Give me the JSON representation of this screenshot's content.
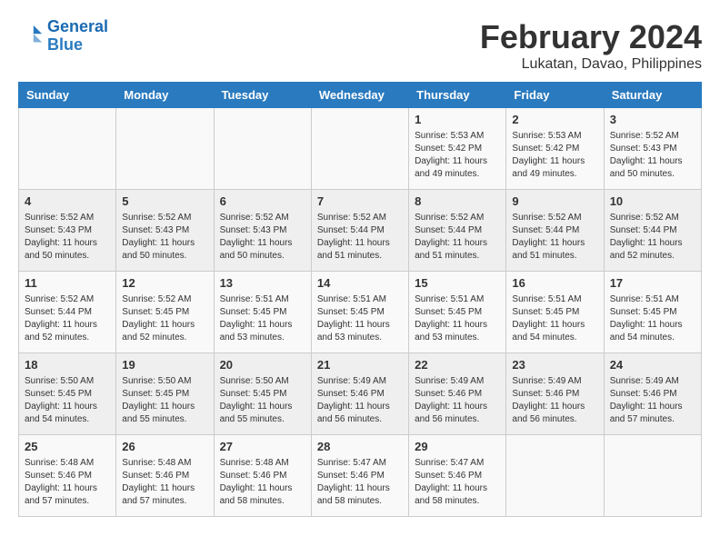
{
  "header": {
    "logo_line1": "General",
    "logo_line2": "Blue",
    "main_title": "February 2024",
    "sub_title": "Lukatan, Davao, Philippines"
  },
  "days_of_week": [
    "Sunday",
    "Monday",
    "Tuesday",
    "Wednesday",
    "Thursday",
    "Friday",
    "Saturday"
  ],
  "weeks": [
    [
      {
        "day": "",
        "info": ""
      },
      {
        "day": "",
        "info": ""
      },
      {
        "day": "",
        "info": ""
      },
      {
        "day": "",
        "info": ""
      },
      {
        "day": "1",
        "info": "Sunrise: 5:53 AM\nSunset: 5:42 PM\nDaylight: 11 hours\nand 49 minutes."
      },
      {
        "day": "2",
        "info": "Sunrise: 5:53 AM\nSunset: 5:42 PM\nDaylight: 11 hours\nand 49 minutes."
      },
      {
        "day": "3",
        "info": "Sunrise: 5:52 AM\nSunset: 5:43 PM\nDaylight: 11 hours\nand 50 minutes."
      }
    ],
    [
      {
        "day": "4",
        "info": "Sunrise: 5:52 AM\nSunset: 5:43 PM\nDaylight: 11 hours\nand 50 minutes."
      },
      {
        "day": "5",
        "info": "Sunrise: 5:52 AM\nSunset: 5:43 PM\nDaylight: 11 hours\nand 50 minutes."
      },
      {
        "day": "6",
        "info": "Sunrise: 5:52 AM\nSunset: 5:43 PM\nDaylight: 11 hours\nand 50 minutes."
      },
      {
        "day": "7",
        "info": "Sunrise: 5:52 AM\nSunset: 5:44 PM\nDaylight: 11 hours\nand 51 minutes."
      },
      {
        "day": "8",
        "info": "Sunrise: 5:52 AM\nSunset: 5:44 PM\nDaylight: 11 hours\nand 51 minutes."
      },
      {
        "day": "9",
        "info": "Sunrise: 5:52 AM\nSunset: 5:44 PM\nDaylight: 11 hours\nand 51 minutes."
      },
      {
        "day": "10",
        "info": "Sunrise: 5:52 AM\nSunset: 5:44 PM\nDaylight: 11 hours\nand 52 minutes."
      }
    ],
    [
      {
        "day": "11",
        "info": "Sunrise: 5:52 AM\nSunset: 5:44 PM\nDaylight: 11 hours\nand 52 minutes."
      },
      {
        "day": "12",
        "info": "Sunrise: 5:52 AM\nSunset: 5:45 PM\nDaylight: 11 hours\nand 52 minutes."
      },
      {
        "day": "13",
        "info": "Sunrise: 5:51 AM\nSunset: 5:45 PM\nDaylight: 11 hours\nand 53 minutes."
      },
      {
        "day": "14",
        "info": "Sunrise: 5:51 AM\nSunset: 5:45 PM\nDaylight: 11 hours\nand 53 minutes."
      },
      {
        "day": "15",
        "info": "Sunrise: 5:51 AM\nSunset: 5:45 PM\nDaylight: 11 hours\nand 53 minutes."
      },
      {
        "day": "16",
        "info": "Sunrise: 5:51 AM\nSunset: 5:45 PM\nDaylight: 11 hours\nand 54 minutes."
      },
      {
        "day": "17",
        "info": "Sunrise: 5:51 AM\nSunset: 5:45 PM\nDaylight: 11 hours\nand 54 minutes."
      }
    ],
    [
      {
        "day": "18",
        "info": "Sunrise: 5:50 AM\nSunset: 5:45 PM\nDaylight: 11 hours\nand 54 minutes."
      },
      {
        "day": "19",
        "info": "Sunrise: 5:50 AM\nSunset: 5:45 PM\nDaylight: 11 hours\nand 55 minutes."
      },
      {
        "day": "20",
        "info": "Sunrise: 5:50 AM\nSunset: 5:45 PM\nDaylight: 11 hours\nand 55 minutes."
      },
      {
        "day": "21",
        "info": "Sunrise: 5:49 AM\nSunset: 5:46 PM\nDaylight: 11 hours\nand 56 minutes."
      },
      {
        "day": "22",
        "info": "Sunrise: 5:49 AM\nSunset: 5:46 PM\nDaylight: 11 hours\nand 56 minutes."
      },
      {
        "day": "23",
        "info": "Sunrise: 5:49 AM\nSunset: 5:46 PM\nDaylight: 11 hours\nand 56 minutes."
      },
      {
        "day": "24",
        "info": "Sunrise: 5:49 AM\nSunset: 5:46 PM\nDaylight: 11 hours\nand 57 minutes."
      }
    ],
    [
      {
        "day": "25",
        "info": "Sunrise: 5:48 AM\nSunset: 5:46 PM\nDaylight: 11 hours\nand 57 minutes."
      },
      {
        "day": "26",
        "info": "Sunrise: 5:48 AM\nSunset: 5:46 PM\nDaylight: 11 hours\nand 57 minutes."
      },
      {
        "day": "27",
        "info": "Sunrise: 5:48 AM\nSunset: 5:46 PM\nDaylight: 11 hours\nand 58 minutes."
      },
      {
        "day": "28",
        "info": "Sunrise: 5:47 AM\nSunset: 5:46 PM\nDaylight: 11 hours\nand 58 minutes."
      },
      {
        "day": "29",
        "info": "Sunrise: 5:47 AM\nSunset: 5:46 PM\nDaylight: 11 hours\nand 58 minutes."
      },
      {
        "day": "",
        "info": ""
      },
      {
        "day": "",
        "info": ""
      }
    ]
  ]
}
